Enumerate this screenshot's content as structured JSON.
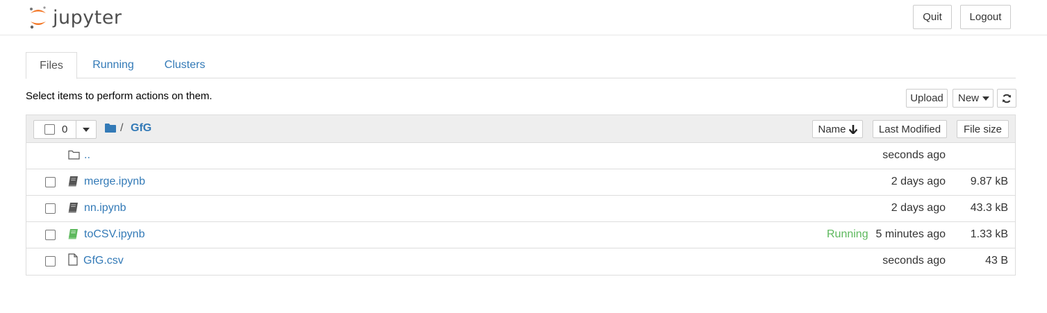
{
  "app": {
    "logo_text": "jupyter"
  },
  "header": {
    "quit_label": "Quit",
    "logout_label": "Logout"
  },
  "tabs": [
    {
      "label": "Files",
      "active": true
    },
    {
      "label": "Running",
      "active": false
    },
    {
      "label": "Clusters",
      "active": false
    }
  ],
  "toolbar": {
    "hint": "Select items to perform actions on them.",
    "upload_label": "Upload",
    "new_label": "New",
    "refresh_icon": "refresh-icon"
  },
  "list_header": {
    "selected_count": "0",
    "breadcrumb_sep": "/",
    "breadcrumb_folder": "GfG",
    "sort_name_label": "Name",
    "sort_modified_label": "Last Modified",
    "sort_size_label": "File size"
  },
  "files": [
    {
      "name": "..",
      "icon": "folder-icon",
      "modified": "seconds ago",
      "size": "",
      "status": ""
    },
    {
      "name": "merge.ipynb",
      "icon": "notebook-icon",
      "modified": "2 days ago",
      "size": "9.87 kB",
      "status": ""
    },
    {
      "name": "nn.ipynb",
      "icon": "notebook-icon",
      "modified": "2 days ago",
      "size": "43.3 kB",
      "status": ""
    },
    {
      "name": "toCSV.ipynb",
      "icon": "notebook-running-icon",
      "modified": "5 minutes ago",
      "size": "1.33 kB",
      "status": "Running"
    },
    {
      "name": "GfG.csv",
      "icon": "file-icon",
      "modified": "seconds ago",
      "size": "43 B",
      "status": ""
    }
  ],
  "colors": {
    "link": "#337ab7",
    "running": "#5cb85c",
    "logo_orange": "#f37726"
  }
}
